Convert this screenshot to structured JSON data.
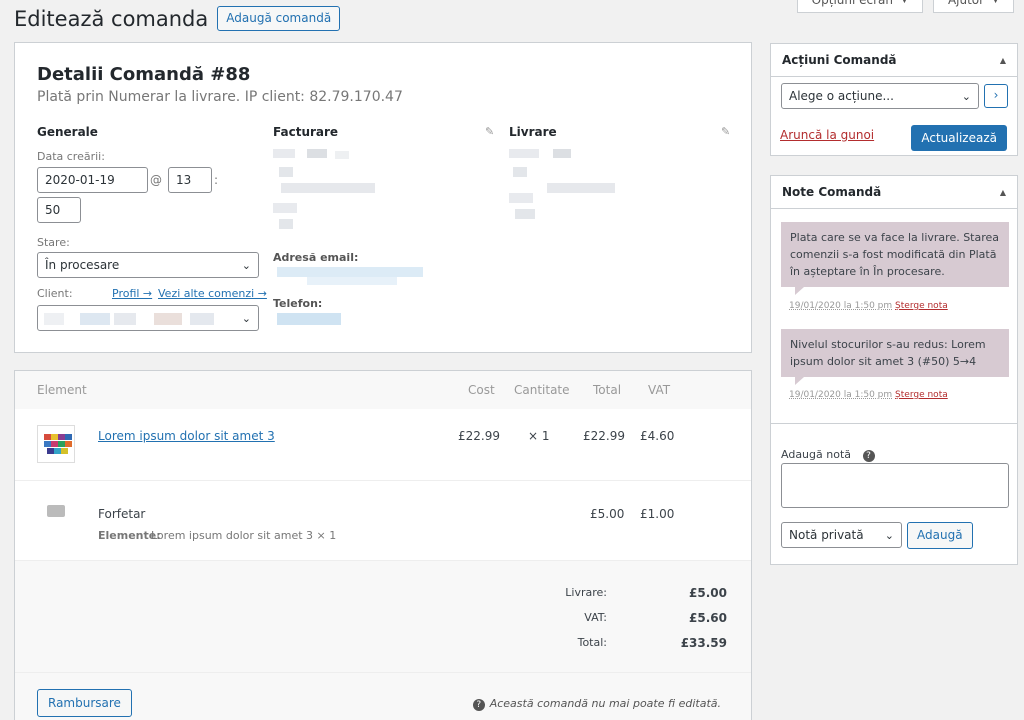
{
  "screen_tabs": [
    {
      "label": "Opțiuni ecran"
    },
    {
      "label": "Ajutor"
    }
  ],
  "header": {
    "title": "Editează comanda",
    "add_button": "Adaugă comandă"
  },
  "order": {
    "heading": "Detalii Comandă #88",
    "meta": "Plată prin Numerar la livrare. IP client: 82.79.170.47",
    "general": {
      "title": "Generale",
      "date_label": "Data creării:",
      "date": "2020-01-19",
      "at": "@",
      "hour": "13",
      "colon": ":",
      "minute": "50",
      "status_label": "Stare:",
      "status": "În procesare",
      "client_label": "Client:",
      "profile_link": "Profil →",
      "other_orders_link": "Vezi alte comenzi →"
    },
    "billing": {
      "title": "Facturare",
      "email_label": "Adresă email:",
      "phone_label": "Telefon:"
    },
    "shipping": {
      "title": "Livrare"
    }
  },
  "items": {
    "columns": {
      "item": "Element",
      "cost": "Cost",
      "qty": "Cantitate",
      "total": "Total",
      "vat": "VAT"
    },
    "products": [
      {
        "name": "Lorem ipsum dolor sit amet 3",
        "cost": "£22.99",
        "qty": "× 1",
        "total": "£22.99",
        "vat": "£4.60"
      }
    ],
    "shipping_line": {
      "name": "Forfetar",
      "items_label": "Elemente:",
      "items_value": "Lorem ipsum dolor sit amet 3 × 1",
      "total": "£5.00",
      "vat": "£1.00"
    },
    "totals": [
      {
        "label": "Livrare:",
        "value": "£5.00"
      },
      {
        "label": "VAT:",
        "value": "£5.60"
      },
      {
        "label": "Total:",
        "value": "£33.59"
      }
    ],
    "refund_button": "Rambursare",
    "not_editable_note": "Această comandă nu mai poate fi editată."
  },
  "order_actions": {
    "title": "Acțiuni Comandă",
    "select": "Alege o acțiune...",
    "go_button": "›",
    "trash_link": "Aruncă la gunoi",
    "update_button": "Actualizează"
  },
  "order_notes": {
    "title": "Note Comandă",
    "notes": [
      {
        "text": "Plata care se va face la livrare. Starea comenzii s-a fost modificată din Plată în așteptare în În procesare.",
        "date": "19/01/2020 la 1:50 pm",
        "delete": "Șterge nota"
      },
      {
        "text": "Nivelul stocurilor s-au redus: Lorem ipsum dolor sit amet 3 (#50) 5→4",
        "date": "19/01/2020 la 1:50 pm",
        "delete": "Șterge nota"
      }
    ],
    "add_label": "Adaugă notă",
    "help_icon": "?",
    "type_select": "Notă privată",
    "add_button": "Adaugă"
  },
  "colors": {
    "accent": "#2271b1",
    "note_bg": "#d7cad2",
    "danger": "#b32d2e"
  }
}
